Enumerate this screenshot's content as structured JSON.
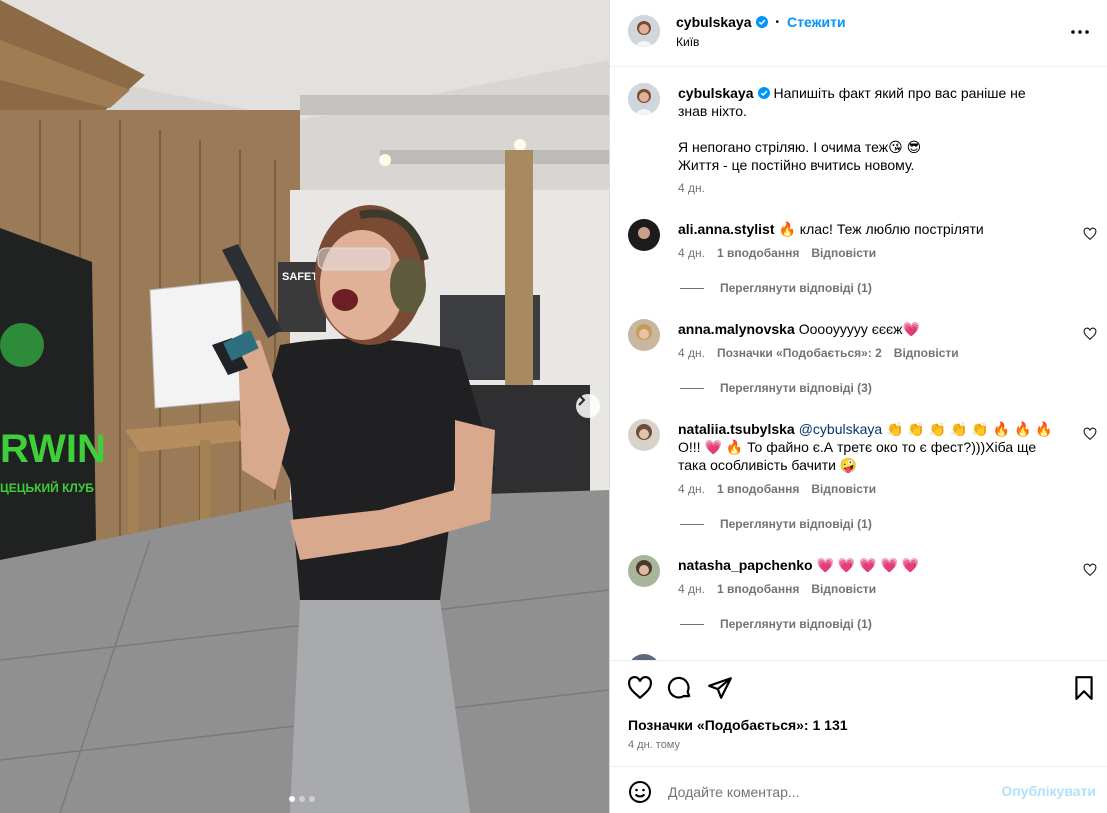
{
  "post": {
    "author": "cybulskaya",
    "follow_label": "Стежити",
    "separator": "•",
    "location": "Київ",
    "caption_lines": [
      "Напишіть факт який про вас раніше не знав ніхто.",
      "",
      "Я непогано стріляю. І очима теж😘 😎",
      "Життя - це постійно вчитись новому."
    ],
    "caption_age": "4 дн.",
    "likes_text": "Позначки «Подобається»: 1 131",
    "date_text": "4 дн. тому"
  },
  "photo": {
    "banner_text": "RWIN",
    "banner_sub": "ЦЕЦЬКИЙ КЛУБ",
    "sign_text": "SAFETY",
    "dots_count": 3
  },
  "comments": [
    {
      "user": "ali.anna.stylist",
      "mention": "",
      "text": "🔥 клас! Теж люблю постріляти",
      "age": "4 дн.",
      "likes": "1 вподобання",
      "reply": "Відповісти",
      "view_replies": "Переглянути відповіді (1)"
    },
    {
      "user": "anna.malynovska",
      "mention": "",
      "text": "Ооооууууу єєєж💗",
      "age": "4 дн.",
      "likes": "Позначки «Подобається»: 2",
      "reply": "Відповісти",
      "view_replies": "Переглянути відповіді (3)"
    },
    {
      "user": "nataliia.tsubylska",
      "mention": "@cybulskaya",
      "text": "👏 👏 👏 👏 👏 🔥 🔥 🔥 О!!! 💗 🔥 То файно є.А третє око то є фест?)))Хіба ще така особливість бачити 🤪",
      "age": "4 дн.",
      "likes": "1 вподобання",
      "reply": "Відповісти",
      "view_replies": "Переглянути відповіді (1)"
    },
    {
      "user": "natasha_papchenko",
      "mention": "",
      "text": "💗 💗 💗 💗 💗",
      "age": "4 дн.",
      "likes": "1 вподобання",
      "reply": "Відповісти",
      "view_replies": "Переглянути відповіді (1)"
    }
  ],
  "add_comment": {
    "placeholder": "Додайте коментар...",
    "publish_label": "Опублікувати"
  },
  "icons": {
    "more": "more-icon",
    "heart": "heart-icon",
    "comment": "comment-icon",
    "share": "share-icon",
    "save": "bookmark-icon",
    "emoji": "emoji-icon",
    "next": "chevron-right-icon",
    "verified": "verified-badge-icon"
  },
  "colors": {
    "accent": "#0095f6",
    "publish_disabled": "#b2dffc",
    "secondary_text": "#737373",
    "mention": "#00376b",
    "heart_emoji": "#ff3e7a"
  }
}
